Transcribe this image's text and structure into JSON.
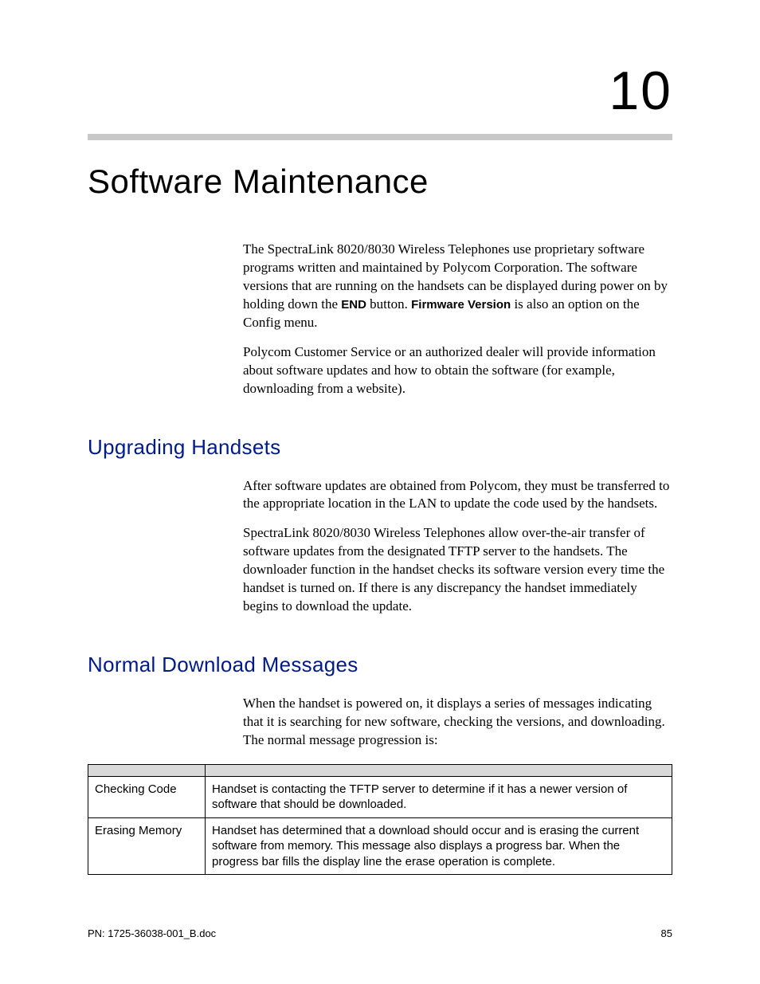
{
  "chapter": {
    "number": "10",
    "title": "Software Maintenance"
  },
  "intro": {
    "p1_a": "The SpectraLink 8020/8030 Wireless Telephones use proprietary software programs written and maintained by Polycom Corporation. The software versions that are running on the handsets can be displayed during power on by holding down the ",
    "p1_end_bold": "END",
    "p1_b": " button. ",
    "p1_fw_bold": "Firmware Version",
    "p1_c": " is also an option on the Config menu.",
    "p2": "Polycom Customer Service or an authorized dealer will provide information about software updates and how to obtain the software (for example, downloading from a website)."
  },
  "section_upgrading": {
    "heading": "Upgrading Handsets",
    "p1": "After software updates are obtained from Polycom, they must be transferred to the appropriate location in the LAN to update the code used by the handsets.",
    "p2": "SpectraLink 8020/8030 Wireless Telephones allow over-the-air transfer of software updates from the designated TFTP server to the handsets. The downloader function in the handset checks its software version every time the handset is turned on. If there is any discrepancy the handset immediately begins to download the update."
  },
  "section_download": {
    "heading": "Normal Download Messages",
    "p1": "When the handset is powered on, it displays a series of messages indicating that it is searching for new software, checking the versions, and downloading. The normal message progression is:"
  },
  "table": {
    "rows": [
      {
        "label": "Checking Code",
        "desc": "Handset is contacting the TFTP server to determine if it has a newer version of software that should be downloaded."
      },
      {
        "label": "Erasing Memory",
        "desc": "Handset has determined that a download should occur and is erasing the current software from memory. This message also displays a progress bar. When the progress bar fills the display line the erase operation is complete."
      }
    ]
  },
  "footer": {
    "left": "PN: 1725-36038-001_B.doc",
    "right": "85"
  }
}
